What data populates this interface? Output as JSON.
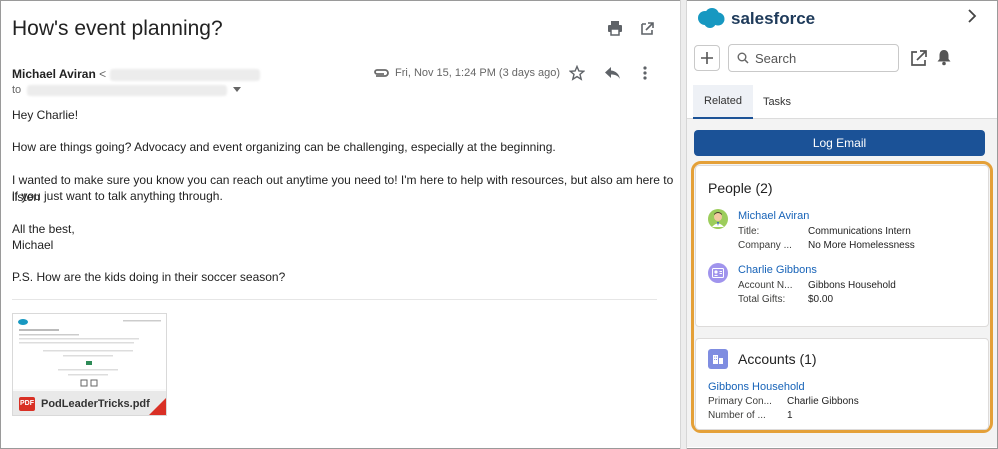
{
  "email": {
    "subject": "How's event planning?",
    "sender_name": "Michael Aviran",
    "sender_lt": "<",
    "to_label": "to",
    "date": "Fri, Nov 15, 1:24 PM (3 days ago)",
    "body": {
      "greeting": "Hey Charlie!",
      "p1": "How are things going? Advocacy and event organizing can be challenging, especially at the beginning.",
      "p2_line1": "I wanted to make sure you know you can reach out anytime you need to! I'm here to help with resources, but also am here to listen",
      "p2_line2": "if you just want to talk anything through.",
      "closing_line1": "All the best,",
      "closing_line2": "Michael",
      "ps": "P.S. How are the kids doing in their soccer season?"
    },
    "attachment": {
      "badge": "PDF",
      "filename": "PodLeaderTricks.pdf"
    },
    "icons": [
      "print-icon",
      "open-in-new-icon",
      "paperclip-icon",
      "star-icon",
      "reply-icon",
      "more-vert-icon"
    ]
  },
  "salesforce": {
    "brand": "salesforce",
    "search_placeholder": "Search",
    "tabs": [
      {
        "label": "Related",
        "active": true
      },
      {
        "label": "Tasks",
        "active": false
      }
    ],
    "log_email_label": "Log Email",
    "people": {
      "title": "People (2)",
      "records": [
        {
          "name": "Michael Aviran",
          "fields": [
            {
              "label": "Title:",
              "value": "Communications Intern"
            },
            {
              "label": "Company ...",
              "value": "No More Homelessness"
            }
          ]
        },
        {
          "name": "Charlie Gibbons",
          "fields": [
            {
              "label": "Account N...",
              "value": "Gibbons Household"
            },
            {
              "label": "Total Gifts:",
              "value": "$0.00"
            }
          ]
        }
      ]
    },
    "accounts": {
      "title": "Accounts (1)",
      "record_name": "Gibbons Household",
      "fields": [
        {
          "label": "Primary Con...",
          "value": "Charlie Gibbons"
        },
        {
          "label": "Number of ...",
          "value": "1"
        }
      ]
    },
    "colors": {
      "brand_blue": "#1b5297",
      "link": "#1763b8",
      "highlight": "#e4a038",
      "contact_icon": "#7f8de1"
    }
  }
}
